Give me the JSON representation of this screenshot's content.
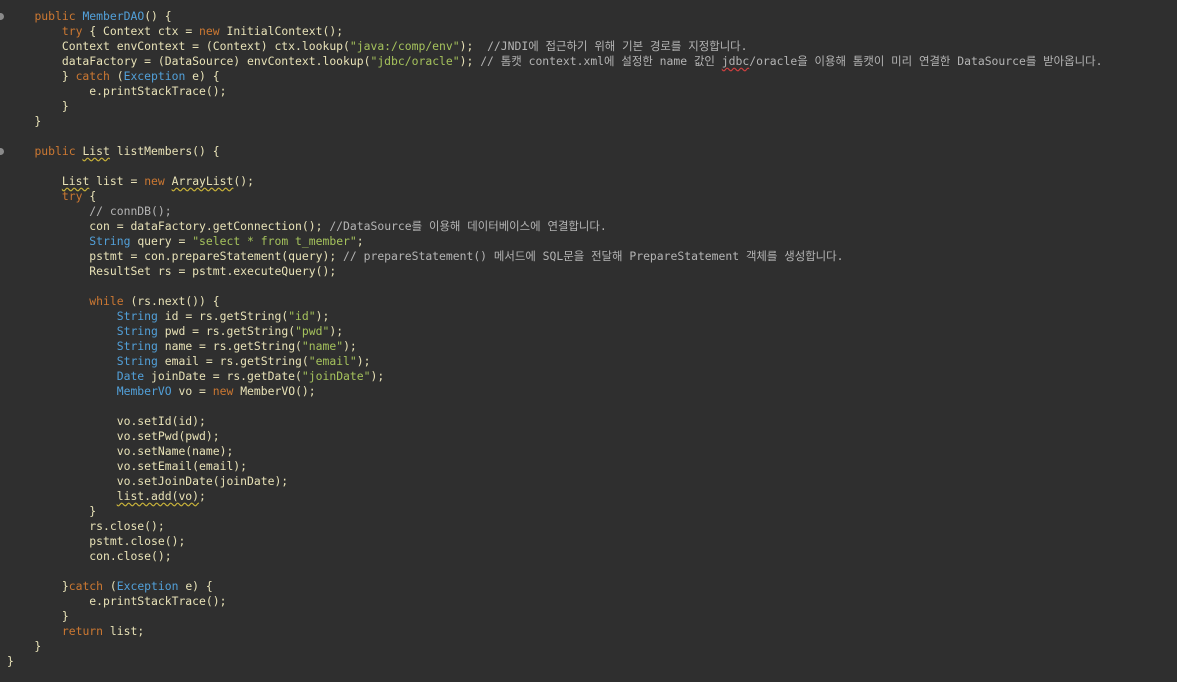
{
  "editor": {
    "lines": [
      [
        {
          "c": "pl",
          "t": "    "
        },
        {
          "c": "kw",
          "t": "public "
        },
        {
          "c": "ty",
          "t": "MemberDAO"
        },
        {
          "c": "pl",
          "t": "() {"
        }
      ],
      [
        {
          "c": "pl",
          "t": "        "
        },
        {
          "c": "kw",
          "t": "try "
        },
        {
          "c": "pl",
          "t": "{ Context ctx = "
        },
        {
          "c": "kw",
          "t": "new "
        },
        {
          "c": "pl",
          "t": "InitialContext();"
        }
      ],
      [
        {
          "c": "pl",
          "t": "        Context envContext = (Context) ctx.lookup("
        },
        {
          "c": "st",
          "t": "\"java:/comp/env\""
        },
        {
          "c": "pl",
          "t": ");  "
        },
        {
          "c": "cm",
          "t": "//JNDI에 접근하기 위해 기본 경로를 지정합니다."
        }
      ],
      [
        {
          "c": "pl",
          "t": "        dataFactory = (DataSource) envContext.lookup("
        },
        {
          "c": "st",
          "t": "\"jdbc/oracle\""
        },
        {
          "c": "pl",
          "t": "); "
        },
        {
          "c": "cm",
          "t": "// 톰캣 context.xml에 설정한 name 값인 "
        },
        {
          "c": "cm err",
          "t": "jdbc"
        },
        {
          "c": "cm",
          "t": "/oracle을 이용해 톰캣이 미리 연결한 DataSource를 받아옵니다."
        }
      ],
      [
        {
          "c": "pl",
          "t": "        } "
        },
        {
          "c": "kw",
          "t": "catch "
        },
        {
          "c": "pl",
          "t": "("
        },
        {
          "c": "ty",
          "t": "Exception "
        },
        {
          "c": "pl",
          "t": "e) {"
        }
      ],
      [
        {
          "c": "pl",
          "t": "            e.printStackTrace();"
        }
      ],
      [
        {
          "c": "pl",
          "t": "        }"
        }
      ],
      [
        {
          "c": "pl",
          "t": "    }"
        }
      ],
      [
        {
          "c": "pl",
          "t": ""
        }
      ],
      [
        {
          "c": "pl",
          "t": "    "
        },
        {
          "c": "kw",
          "t": "public "
        },
        {
          "c": "pl warn",
          "t": "List"
        },
        {
          "c": "pl",
          "t": " listMembers() {"
        }
      ],
      [
        {
          "c": "pl",
          "t": ""
        }
      ],
      [
        {
          "c": "pl",
          "t": "        "
        },
        {
          "c": "pl warn",
          "t": "List"
        },
        {
          "c": "pl",
          "t": " list = "
        },
        {
          "c": "kw",
          "t": "new "
        },
        {
          "c": "pl warn",
          "t": "ArrayList"
        },
        {
          "c": "pl",
          "t": "();"
        }
      ],
      [
        {
          "c": "pl",
          "t": "        "
        },
        {
          "c": "kw",
          "t": "try "
        },
        {
          "c": "pl",
          "t": "{"
        }
      ],
      [
        {
          "c": "pl",
          "t": "            "
        },
        {
          "c": "cm",
          "t": "// connDB();"
        }
      ],
      [
        {
          "c": "pl",
          "t": "            con = dataFactory.getConnection(); "
        },
        {
          "c": "cm",
          "t": "//DataSource를 이용해 데이터베이스에 연결합니다."
        }
      ],
      [
        {
          "c": "pl",
          "t": "            "
        },
        {
          "c": "ty",
          "t": "String "
        },
        {
          "c": "pl",
          "t": "query = "
        },
        {
          "c": "st",
          "t": "\"select * from t_member\""
        },
        {
          "c": "pl",
          "t": ";"
        }
      ],
      [
        {
          "c": "pl",
          "t": "            pstmt = con.prepareStatement(query); "
        },
        {
          "c": "cm",
          "t": "// prepareStatement() 메서드에 SQL문을 전달해 PrepareStatement 객체를 생성합니다."
        }
      ],
      [
        {
          "c": "pl",
          "t": "            ResultSet rs = pstmt.executeQuery();"
        }
      ],
      [
        {
          "c": "pl",
          "t": ""
        }
      ],
      [
        {
          "c": "pl",
          "t": "            "
        },
        {
          "c": "kw",
          "t": "while "
        },
        {
          "c": "pl",
          "t": "(rs.next()) {"
        }
      ],
      [
        {
          "c": "pl",
          "t": "                "
        },
        {
          "c": "ty",
          "t": "String "
        },
        {
          "c": "pl",
          "t": "id = rs.getString("
        },
        {
          "c": "st",
          "t": "\"id\""
        },
        {
          "c": "pl",
          "t": ");"
        }
      ],
      [
        {
          "c": "pl",
          "t": "                "
        },
        {
          "c": "ty",
          "t": "String "
        },
        {
          "c": "pl",
          "t": "pwd = rs.getString("
        },
        {
          "c": "st",
          "t": "\"pwd\""
        },
        {
          "c": "pl",
          "t": ");"
        }
      ],
      [
        {
          "c": "pl",
          "t": "                "
        },
        {
          "c": "ty",
          "t": "String "
        },
        {
          "c": "pl",
          "t": "name = rs.getString("
        },
        {
          "c": "st",
          "t": "\"name\""
        },
        {
          "c": "pl",
          "t": ");"
        }
      ],
      [
        {
          "c": "pl",
          "t": "                "
        },
        {
          "c": "ty",
          "t": "String "
        },
        {
          "c": "pl",
          "t": "email = rs.getString("
        },
        {
          "c": "st",
          "t": "\"email\""
        },
        {
          "c": "pl",
          "t": ");"
        }
      ],
      [
        {
          "c": "pl",
          "t": "                "
        },
        {
          "c": "ty",
          "t": "Date "
        },
        {
          "c": "pl",
          "t": "joinDate = rs.getDate("
        },
        {
          "c": "st",
          "t": "\"joinDate\""
        },
        {
          "c": "pl",
          "t": ");"
        }
      ],
      [
        {
          "c": "pl",
          "t": "                "
        },
        {
          "c": "ty",
          "t": "MemberVO "
        },
        {
          "c": "pl",
          "t": "vo = "
        },
        {
          "c": "kw",
          "t": "new "
        },
        {
          "c": "pl",
          "t": "MemberVO();"
        }
      ],
      [
        {
          "c": "pl",
          "t": ""
        }
      ],
      [
        {
          "c": "pl",
          "t": "                vo.setId(id);"
        }
      ],
      [
        {
          "c": "pl",
          "t": "                vo.setPwd(pwd);"
        }
      ],
      [
        {
          "c": "pl",
          "t": "                vo.setName(name);"
        }
      ],
      [
        {
          "c": "pl",
          "t": "                vo.setEmail(email);"
        }
      ],
      [
        {
          "c": "pl",
          "t": "                vo.setJoinDate(joinDate);"
        }
      ],
      [
        {
          "c": "pl",
          "t": "                "
        },
        {
          "c": "pl warn",
          "t": "list.add(vo)"
        },
        {
          "c": "pl",
          "t": ";"
        }
      ],
      [
        {
          "c": "pl",
          "t": "            }"
        }
      ],
      [
        {
          "c": "pl",
          "t": "            rs.close();"
        }
      ],
      [
        {
          "c": "pl",
          "t": "            pstmt.close();"
        }
      ],
      [
        {
          "c": "pl",
          "t": "            con.close();"
        }
      ],
      [
        {
          "c": "pl",
          "t": ""
        }
      ],
      [
        {
          "c": "pl",
          "t": "        }"
        },
        {
          "c": "kw",
          "t": "catch "
        },
        {
          "c": "pl",
          "t": "("
        },
        {
          "c": "ty",
          "t": "Exception "
        },
        {
          "c": "pl",
          "t": "e) {"
        }
      ],
      [
        {
          "c": "pl",
          "t": "            e.printStackTrace();"
        }
      ],
      [
        {
          "c": "pl",
          "t": "        }"
        }
      ],
      [
        {
          "c": "pl",
          "t": "        "
        },
        {
          "c": "kw",
          "t": "return "
        },
        {
          "c": "pl",
          "t": "list;"
        }
      ],
      [
        {
          "c": "pl",
          "t": "    }"
        }
      ],
      [
        {
          "c": "pl",
          "t": "}"
        }
      ]
    ],
    "markers": [
      0,
      9
    ]
  }
}
